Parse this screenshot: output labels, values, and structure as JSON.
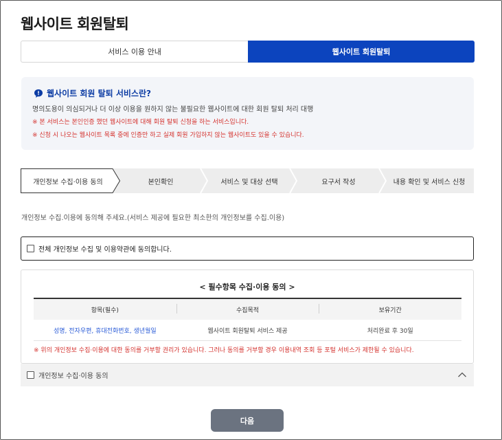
{
  "page": {
    "title": "웹사이트 회원탈퇴"
  },
  "tabs": [
    {
      "label": "서비스 이용 안내",
      "active": false
    },
    {
      "label": "웹사이트 회원탈퇴",
      "active": true
    }
  ],
  "info": {
    "title": "웹사이트 회원 탈퇴 서비스란?",
    "description": "명의도용이 의심되거나 더 이상 이용을 원하지 않는 불필요한 웹사이트에 대한 회원 탈퇴 처리 대행",
    "notes": [
      "※ 본 서비스는 본인인증 했던 웹사이트에 대해 회원 탈퇴 신청을 하는 서비스입니다.",
      "※ 신청 시 나오는 웹사이트 목록 중에 인증만 하고 실제 회원 가입하지 않는 웹사이트도 있을 수 있습니다."
    ]
  },
  "steps": [
    {
      "label": "개인정보 수집·이용 동의",
      "active": true
    },
    {
      "label": "본인확인",
      "active": false
    },
    {
      "label": "서비스 및 대상 선택",
      "active": false
    },
    {
      "label": "요구서 작성",
      "active": false
    },
    {
      "label": "내용 확인 및 서비스 신청",
      "active": false
    }
  ],
  "instruction": "개인정보 수집.이용에 동의해 주세요.(서비스 제공에 필요한 최소한의 개인정보를 수집.이용)",
  "agree_all": {
    "label": "전체 개인정보 수집 및 이용약관에 동의합니다.",
    "checked": false
  },
  "consent": {
    "title": "< 필수항목 수집·이용 동의 >",
    "columns": [
      "항목(필수)",
      "수집목적",
      "보유기간"
    ],
    "rows": [
      [
        "성명, 전자우편, 휴대전화번호, 생년월일",
        "웹사이트 회원탈퇴 서비스 제공",
        "처리완료 후 30일"
      ]
    ],
    "note": "※ 위의 개인정보 수집·이용에 대한 동의를 거부할 권리가 있습니다. 그러나 동의를 거부할 경우 이용내역 조회 등 포털 서비스가 제한될 수 있습니다."
  },
  "accordion": {
    "label": "개인정보 수집·이용 동의",
    "checked": false,
    "icon": "chevron-up-icon"
  },
  "next_button": {
    "label": "다음"
  },
  "colors": {
    "primary": "#0c44be",
    "title_blue": "#0c3ca4",
    "warning_red": "#d4322e",
    "link_blue": "#2a5bd7",
    "button_gray": "#6b7380",
    "info_bg": "#f3f5f9",
    "step_bg": "#ededed"
  }
}
